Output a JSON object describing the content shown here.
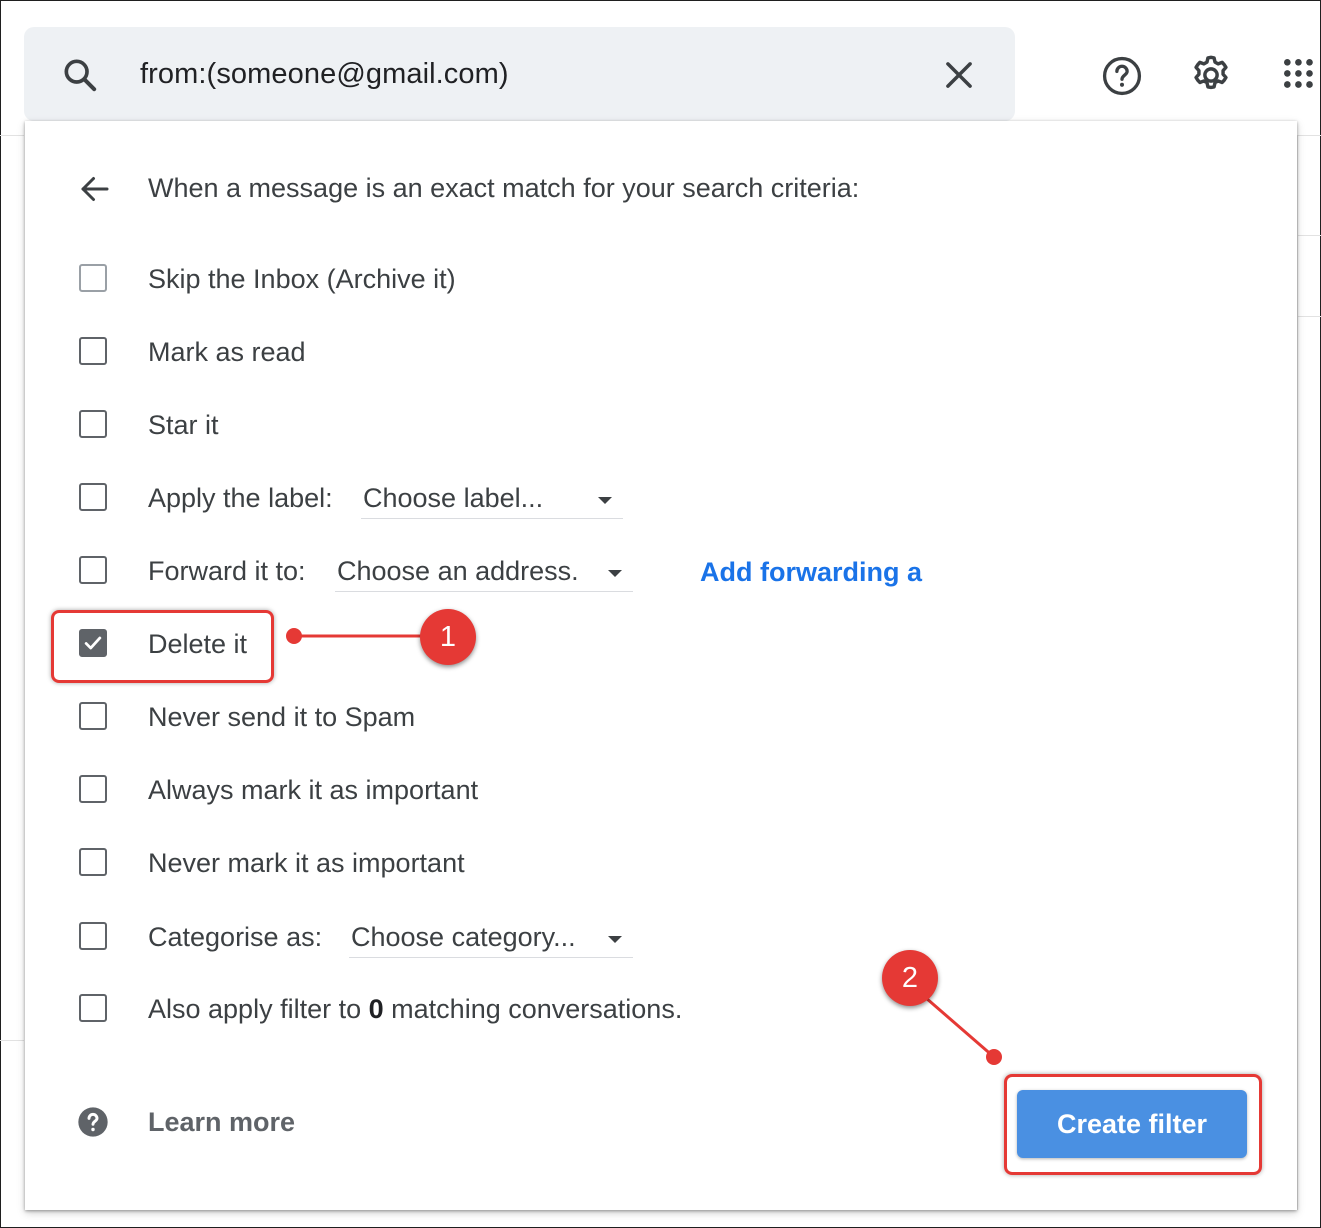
{
  "search": {
    "query": "from:(someone@gmail.com)"
  },
  "filter_panel": {
    "header": "When a message is an exact match for your search criteria:",
    "options": [
      {
        "label": "Skip the Inbox (Archive it)",
        "checked": false
      },
      {
        "label": "Mark as read",
        "checked": false
      },
      {
        "label": "Star it",
        "checked": false
      },
      {
        "label": "Apply the label:",
        "checked": false,
        "select_value": "Choose label..."
      },
      {
        "label": "Forward it to:",
        "checked": false,
        "select_value": "Choose an address.",
        "link": "Add forwarding a"
      },
      {
        "label": "Delete it",
        "checked": true
      },
      {
        "label": "Never send it to Spam",
        "checked": false
      },
      {
        "label": "Always mark it as important",
        "checked": false
      },
      {
        "label": "Never mark it as important",
        "checked": false
      },
      {
        "label": "Categorise as:",
        "checked": false,
        "select_value": "Choose category..."
      },
      {
        "label_prefix": "Also apply filter to",
        "label_count": "0",
        "label_suffix": "matching conversations.",
        "checked": false
      }
    ],
    "learn_more": "Learn more",
    "create_button": "Create filter"
  },
  "annotations": {
    "step1": "1",
    "step2": "2",
    "color": "#e53935"
  },
  "colors": {
    "primary_button": "#4a90e2",
    "link": "#1a73e8",
    "search_bg": "#eef1f4"
  }
}
